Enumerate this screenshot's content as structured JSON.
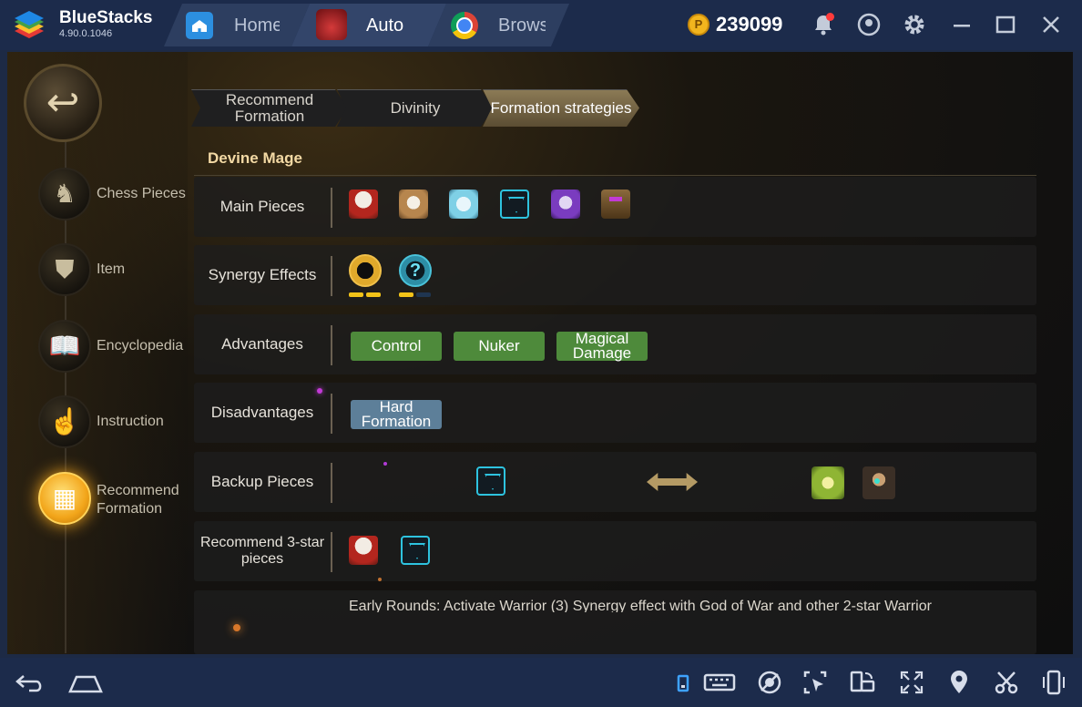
{
  "window": {
    "app_name": "BlueStacks",
    "version": "4.90.0.1046",
    "tabs": [
      {
        "label": "Home",
        "icon": "home-icon"
      },
      {
        "label": "Auto",
        "icon": "auto-chess-icon",
        "active": true
      },
      {
        "label": "Brows",
        "icon": "chrome-icon"
      }
    ],
    "coins": "239099",
    "coin_symbol": "P"
  },
  "sidebar": {
    "back_icon": "↩",
    "items": [
      {
        "label": "Chess Pieces",
        "icon": "♞"
      },
      {
        "label": "Item",
        "icon": "⛊"
      },
      {
        "label": "Encyclopedia",
        "icon": "📖"
      },
      {
        "label": "Instruction",
        "icon": "☝"
      },
      {
        "label": "Recommend Formation",
        "icon": "▦",
        "active": true
      }
    ]
  },
  "crumbs": [
    {
      "label": "Recommend Formation"
    },
    {
      "label": "Divinity"
    },
    {
      "label": "Formation strategies",
      "active": true
    }
  ],
  "section": {
    "title": "Devine Mage"
  },
  "rows": {
    "main_pieces": {
      "label": "Main Pieces"
    },
    "synergy": {
      "label": "Synergy Effects",
      "teal_symbol": "?"
    },
    "advantages": {
      "label": "Advantages",
      "tags": [
        "Control",
        "Nuker",
        "Magical Damage"
      ]
    },
    "disadvantages": {
      "label": "Disadvantages",
      "tags": [
        "Hard Formation"
      ]
    },
    "backup": {
      "label": "Backup Pieces"
    },
    "three_star": {
      "label": "Recommend 3-star pieces"
    }
  },
  "strategy_text": "Early Rounds: Activate Warrior (3) Synergy effect with God of War and other 2-star Warrior",
  "colors": {
    "accent_gold": "#f3d9a4",
    "tag_green": "#4e8a3b",
    "tag_blue": "#5d7f99",
    "synergy_active": "#f2c318",
    "synergy_inactive": "#1f3550"
  }
}
